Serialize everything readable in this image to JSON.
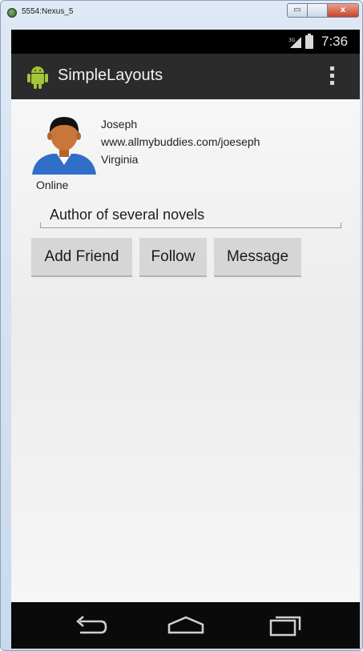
{
  "window": {
    "title": "5554:Nexus_5",
    "min_symbol": "▭",
    "max_symbol": "",
    "close_symbol": "x"
  },
  "statusbar": {
    "network": "3G",
    "time": "7:36",
    "signal_icon": "signal-icon",
    "battery_icon": "battery-icon"
  },
  "actionbar": {
    "title": "SimpleLayouts",
    "app_icon": "android-icon",
    "menu_icon": "overflow-menu-icon"
  },
  "profile": {
    "name": "Joseph",
    "website": "www.allmybuddies.com/joeseph",
    "location": "Virginia",
    "status": "Online",
    "bio": "Author of several novels"
  },
  "buttons": {
    "add_friend": "Add Friend",
    "follow": "Follow",
    "message": "Message"
  },
  "navbar": {
    "back_icon": "back-icon",
    "home_icon": "home-icon",
    "recent_icon": "recent-apps-icon"
  },
  "colors": {
    "actionbar_bg": "#2b2b2b",
    "statusbar_bg": "#000000",
    "button_bg": "#d6d6d6",
    "android_green": "#a4c639"
  }
}
